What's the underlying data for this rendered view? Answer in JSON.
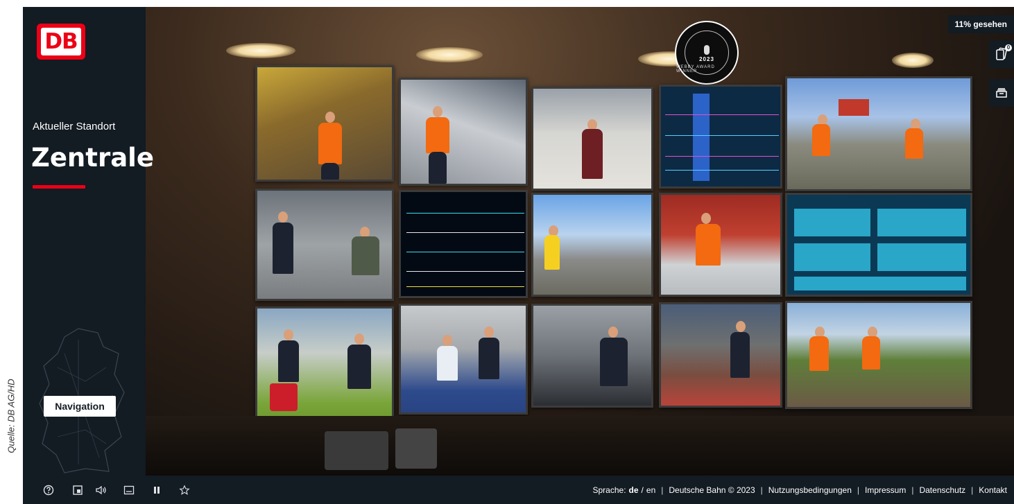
{
  "source_credit": "Quelle: DB AG/HD",
  "sidebar": {
    "logo_text": "DB",
    "location_label": "Aktueller Standort",
    "location_name": "Zentrale",
    "navigation_button": "Navigation"
  },
  "top_right": {
    "progress_text": "11% gesehen",
    "cards_badge": "0"
  },
  "award": {
    "year": "2023",
    "caption": "WEBBY AWARD WINNER"
  },
  "bottom_controls": [
    "help-icon",
    "fullscreen-icon",
    "volume-icon",
    "subtitles-icon",
    "pause-icon",
    "star-icon"
  ],
  "footer": {
    "language_label": "Sprache:",
    "language_active": "de",
    "language_separator": "/",
    "language_other": "en",
    "copyright": "Deutsche Bahn © 2023",
    "terms": "Nutzungsbedingungen",
    "imprint": "Impressum",
    "privacy": "Datenschutz",
    "contact": "Kontakt"
  },
  "colors": {
    "brand_red": "#ec0016",
    "sidebar_bg": "#131b23",
    "text_white": "#ffffff"
  }
}
